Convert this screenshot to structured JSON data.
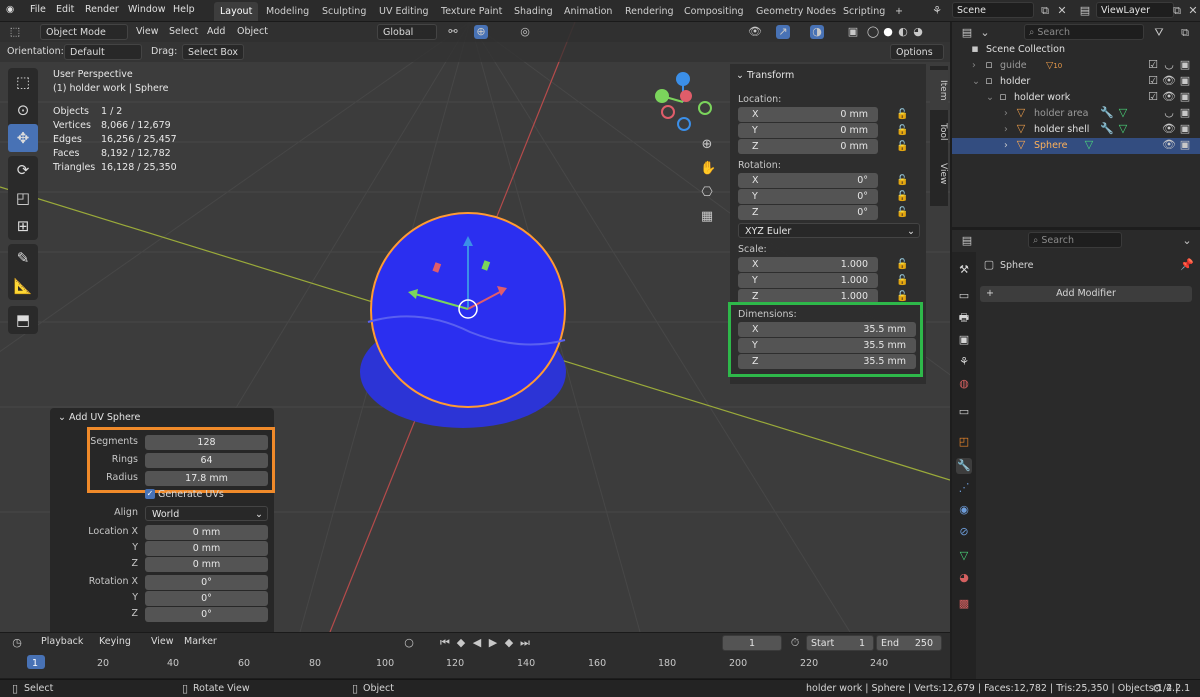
{
  "topbar": {
    "menus": [
      "File",
      "Edit",
      "Render",
      "Window",
      "Help"
    ],
    "workspaces": [
      "Layout",
      "Modeling",
      "Sculpting",
      "UV Editing",
      "Texture Paint",
      "Shading",
      "Animation",
      "Rendering",
      "Compositing",
      "Geometry Nodes",
      "Scripting"
    ],
    "active_workspace": "Layout",
    "add_ws": "+",
    "scene": "Scene",
    "viewlayer": "ViewLayer"
  },
  "viewport_header": {
    "mode": "Object Mode",
    "menus": [
      "View",
      "Select",
      "Add",
      "Object"
    ],
    "transform_orientation": "Global",
    "orientation_label": "Orientation:",
    "orientation_value": "Default",
    "drag_label": "Drag:",
    "drag_value": "Select Box",
    "options": "Options"
  },
  "overlay_stats": {
    "view": "User Perspective",
    "object": "(1) holder work | Sphere",
    "rows": [
      [
        "Objects",
        "1 / 2"
      ],
      [
        "Vertices",
        "8,066 / 12,679"
      ],
      [
        "Edges",
        "16,256 / 25,457"
      ],
      [
        "Faces",
        "8,192 / 12,782"
      ],
      [
        "Triangles",
        "16,128 / 25,350"
      ]
    ]
  },
  "npanel": {
    "title": "Transform",
    "location_label": "Location:",
    "location": [
      [
        "X",
        "0 mm"
      ],
      [
        "Y",
        "0 mm"
      ],
      [
        "Z",
        "0 mm"
      ]
    ],
    "rotation_label": "Rotation:",
    "rotation": [
      [
        "X",
        "0°"
      ],
      [
        "Y",
        "0°"
      ],
      [
        "Z",
        "0°"
      ]
    ],
    "rotation_mode": "XYZ Euler",
    "scale_label": "Scale:",
    "scale": [
      [
        "X",
        "1.000"
      ],
      [
        "Y",
        "1.000"
      ],
      [
        "Z",
        "1.000"
      ]
    ],
    "dimensions_label": "Dimensions:",
    "dimensions": [
      [
        "X",
        "35.5 mm"
      ],
      [
        "Y",
        "35.5 mm"
      ],
      [
        "Z",
        "35.5 mm"
      ]
    ],
    "tabs": [
      "Item",
      "Tool",
      "View"
    ]
  },
  "redo_panel": {
    "title": "Add UV Sphere",
    "segments_label": "Segments",
    "segments": "128",
    "rings_label": "Rings",
    "rings": "64",
    "radius_label": "Radius",
    "radius": "17.8 mm",
    "generate_uvs": "Generate UVs",
    "align_label": "Align",
    "align": "World",
    "loc_x_label": "Location X",
    "loc_y_label": "Y",
    "loc_z_label": "Z",
    "loc": [
      "0 mm",
      "0 mm",
      "0 mm"
    ],
    "rot_x_label": "Rotation X",
    "rot_y_label": "Y",
    "rot_z_label": "Z",
    "rot": [
      "0°",
      "0°",
      "0°"
    ]
  },
  "timeline": {
    "menus": [
      "Playback",
      "Keying",
      "View",
      "Marker"
    ],
    "current_frame": "1",
    "start_label": "Start",
    "start": "1",
    "end_label": "End",
    "end": "250",
    "ticks": [
      "1",
      "20",
      "40",
      "60",
      "80",
      "100",
      "120",
      "140",
      "160",
      "180",
      "200",
      "220",
      "240"
    ]
  },
  "status": {
    "select": "Select",
    "rotate": "Rotate View",
    "object": "Object",
    "info": "holder work | Sphere | Verts:12,679 | Faces:12,782 | Tris:25,350 | Objects:1/2 |",
    "version": "4.2.1"
  },
  "outliner": {
    "search_placeholder": "Search",
    "root": "Scene Collection",
    "items": [
      {
        "name": "guide",
        "badge": "10"
      },
      {
        "name": "holder"
      },
      {
        "name": "holder work"
      },
      {
        "name": "holder area"
      },
      {
        "name": "holder shell"
      },
      {
        "name": "Sphere"
      }
    ]
  },
  "properties": {
    "search_placeholder": "Search",
    "object_name": "Sphere",
    "add_modifier": "Add Modifier"
  }
}
